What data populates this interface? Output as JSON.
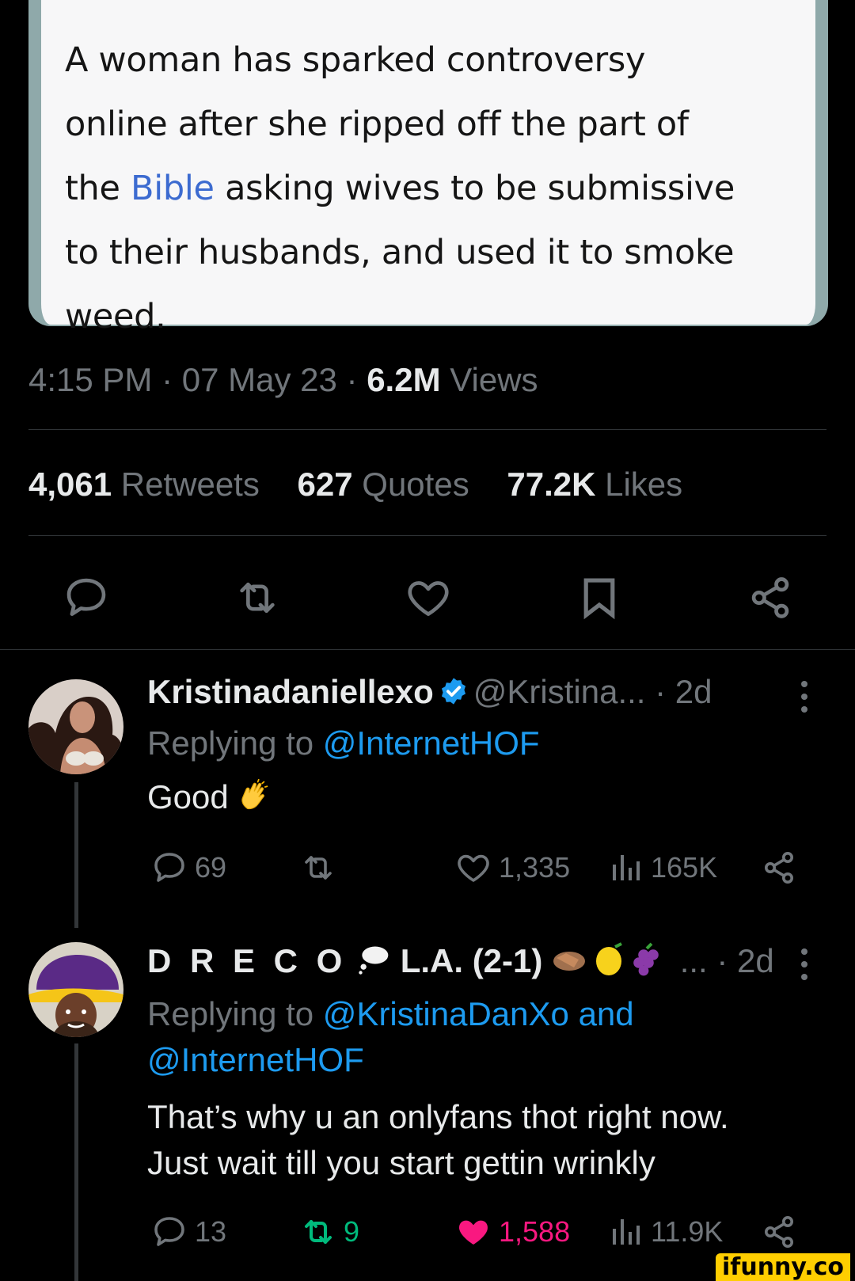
{
  "quoted_card": {
    "line1": "A woman has sparked controversy",
    "line2": "online after she ripped off the part of",
    "line3_prefix": "the ",
    "line3_link": "Bible",
    "line3_suffix": " asking wives to be submissive",
    "line4": "to their husbands, and used it to smoke",
    "line5": "weed."
  },
  "tweet_meta": {
    "time": "4:15 PM",
    "sep1": " · ",
    "date": "07 May 23",
    "sep2": " · ",
    "views_count": "6.2M",
    "views_label": " Views"
  },
  "tweet_stats": {
    "retweets_count": "4,061",
    "retweets_label": " Retweets",
    "quotes_count": "627",
    "quotes_label": " Quotes",
    "likes_count": "77.2K",
    "likes_label": " Likes"
  },
  "tweet_actions": [
    "reply-icon",
    "retweet-icon",
    "like-icon",
    "bookmark-icon",
    "share-icon"
  ],
  "replies": [
    {
      "name": "Kristinadaniellexo",
      "verified": true,
      "handle": "@Kristina...",
      "time": " · 2d",
      "replying_prefix": "Replying to ",
      "replying_mentions": "@InternetHOF",
      "replying_mentions_2": "",
      "body_line1": "Good",
      "body_emoji": "👏",
      "body_line2": "",
      "reply_count": "69",
      "retweet_count": "",
      "like_count": "1,335",
      "view_count": "165K",
      "liked": false,
      "retweeted": false
    },
    {
      "name": "D R E C O",
      "name_emoji": "💭",
      "name_suffix": " L.A. (2-1) ",
      "name_emojis_tail": "🤝🍋🍇",
      "handle": " ...",
      "time": " · 2d",
      "replying_prefix": "Replying to ",
      "replying_mentions": "@KristinaDanXo and",
      "replying_mentions_2": "@InternetHOF",
      "body_line1": "That’s why u an onlyfans thot right now.",
      "body_line2": "Just wait till you start gettin wrinkly",
      "reply_count": "13",
      "retweet_count": "9",
      "like_count": "1,588",
      "view_count": "11.9K",
      "liked": true,
      "retweeted": true
    }
  ],
  "watermark": "ifunny.co",
  "colors": {
    "background": "#000000",
    "text_primary": "#e7e9ea",
    "text_secondary": "#71767b",
    "link": "#1d9bf0",
    "liked_pink": "#f91880",
    "retweet_green": "#00ba7c",
    "verified_blue": "#1d9bf0"
  }
}
